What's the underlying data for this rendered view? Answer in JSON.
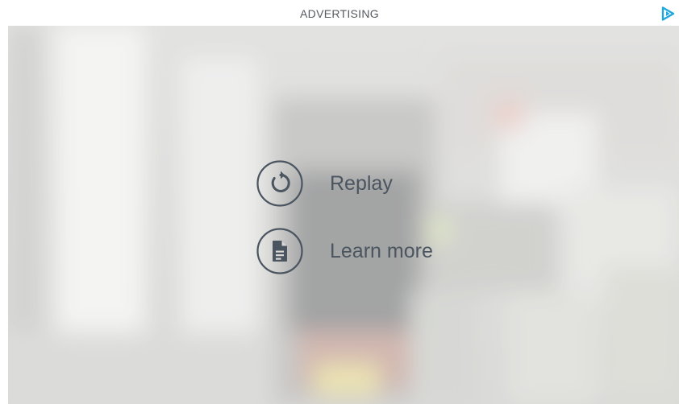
{
  "header": {
    "label": "ADVERTISING"
  },
  "icons": {
    "ad_choices": "ad-choices-triangle-icon",
    "replay": "replay-arrow-icon",
    "learn_more": "document-icon"
  },
  "menu": {
    "replay_label": "Replay",
    "learn_more_label": "Learn more"
  },
  "colors": {
    "accent": "#1fa8e0",
    "icon_stroke": "#4b5560",
    "label_text": "#555a5f"
  }
}
